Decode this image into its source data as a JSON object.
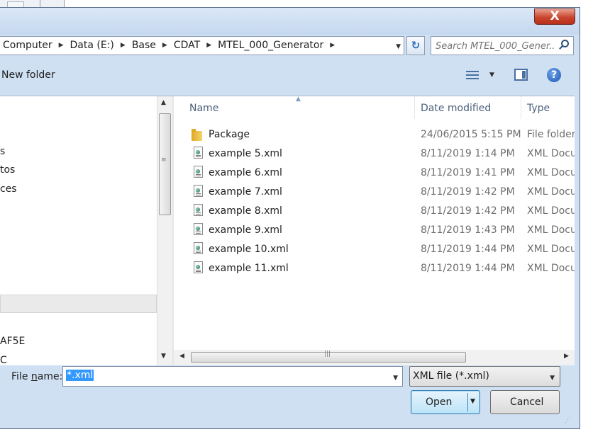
{
  "address": {
    "crumbs": [
      "Computer",
      "Data (E:)",
      "Base",
      "CDAT",
      "MTEL_000_Generator"
    ]
  },
  "search": {
    "placeholder": "Search MTEL_000_Gener..."
  },
  "toolbar": {
    "new_folder": "New folder"
  },
  "nav": {
    "items": [
      "s",
      "tos",
      "ces",
      "",
      "AF5E",
      "C"
    ]
  },
  "columns": {
    "name": "Name",
    "date": "Date modified",
    "type": "Type"
  },
  "files": [
    {
      "name": "Package",
      "date": "24/06/2015 5:15 PM",
      "type": "File folder",
      "icon": "folder-icon"
    },
    {
      "name": "example 5.xml",
      "date": "8/11/2019 1:14 PM",
      "type": "XML Docu",
      "icon": "xml-file-icon"
    },
    {
      "name": "example 6.xml",
      "date": "8/11/2019 1:41 PM",
      "type": "XML Docu",
      "icon": "xml-file-icon"
    },
    {
      "name": "example 7.xml",
      "date": "8/11/2019 1:42 PM",
      "type": "XML Docu",
      "icon": "xml-file-icon"
    },
    {
      "name": "example 8.xml",
      "date": "8/11/2019 1:42 PM",
      "type": "XML Docu",
      "icon": "xml-file-icon"
    },
    {
      "name": "example 9.xml",
      "date": "8/11/2019 1:43 PM",
      "type": "XML Docu",
      "icon": "xml-file-icon"
    },
    {
      "name": "example 10.xml",
      "date": "8/11/2019 1:44 PM",
      "type": "XML Docu",
      "icon": "xml-file-icon"
    },
    {
      "name": "example 11.xml",
      "date": "8/11/2019 1:44 PM",
      "type": "XML Docu",
      "icon": "xml-file-icon"
    }
  ],
  "filename": {
    "label_pre": "File ",
    "label_accel": "n",
    "label_post": "ame:",
    "value": "*.xml"
  },
  "filetype": {
    "value": "XML file (*.xml)"
  },
  "buttons": {
    "open": "Open",
    "cancel": "Cancel",
    "close_glyph": "X"
  },
  "glyphs": {
    "help": "?",
    "refresh": "↻"
  },
  "colors": {
    "selection": "#3399ff",
    "open_button_border": "#3c7fb1",
    "close_button": "#c9452e"
  }
}
